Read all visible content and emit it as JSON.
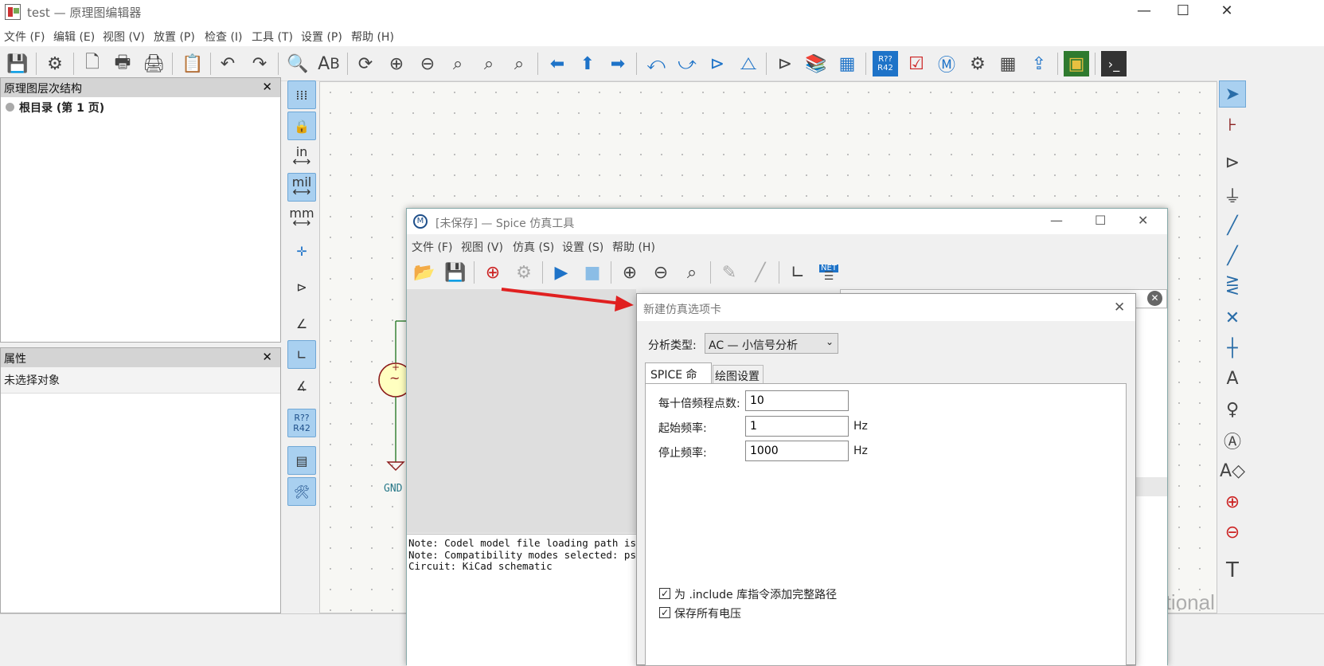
{
  "window": {
    "title": "test — 原理图编辑器",
    "minimize": "—",
    "maximize": "☐",
    "close": "✕"
  },
  "menu": [
    "文件 (F)",
    "编辑 (E)",
    "视图 (V)",
    "放置 (P)",
    "检查 (I)",
    "工具 (T)",
    "设置 (P)",
    "帮助 (H)"
  ],
  "toolbar": [
    "save-icon",
    "schematic-setup-icon",
    "page-settings-icon",
    "print-icon",
    "plot-icon",
    "paste-icon",
    "undo-icon",
    "redo-icon",
    "find-icon",
    "find-replace-icon",
    "refresh-icon",
    "zoom-in-icon",
    "zoom-out-icon",
    "zoom-fit-icon",
    "zoom-objects-icon",
    "zoom-selection-icon",
    "navigate-back-icon",
    "navigate-up-icon",
    "navigate-forward-icon",
    "rotate-ccw-icon",
    "rotate-cw-icon",
    "mirror-v-icon",
    "mirror-h-icon",
    "symbol-editor-icon",
    "symbol-browser-icon",
    "footprint-editor-icon",
    "annotate-icon",
    "erc-icon",
    "simulator-icon",
    "assign-footprints-icon",
    "bom-table-icon",
    "bom-export-icon",
    "pcb-editor-icon",
    "scripting-console-icon"
  ],
  "hierarchy": {
    "title": "原理图层次结构",
    "close": "✕",
    "root": "根目录 (第 1 页)"
  },
  "properties": {
    "title": "属性",
    "close": "✕",
    "empty": "未选择对象"
  },
  "left_toolbar": {
    "in": "in",
    "mil": "mil",
    "mm": "mm",
    "annotate_top": "R??",
    "annotate_bottom": "R42"
  },
  "canvas": {
    "gnd_label": "GND",
    "plus": "+",
    "source": "~"
  },
  "watermark": "CSDN @FakeOccupational",
  "spice": {
    "title": "[未保存] — Spice 仿真工具",
    "menu": [
      "文件 (F)",
      "视图 (V)",
      "仿真 (S)",
      "设置 (S)",
      "帮助 (H)"
    ],
    "log": [
      "Note: Codel model file loading path is",
      "Note: Compatibility modes selected: ps",
      "Circuit: KiCad schematic"
    ],
    "net_badge": "NET"
  },
  "dialog": {
    "title": "新建仿真选项卡",
    "analysis_label": "分析类型:",
    "analysis_value": "AC  —  小信号分析",
    "tabs": [
      "SPICE 命令",
      "绘图设置"
    ],
    "fields": [
      {
        "label": "每十倍频程点数:",
        "value": "10",
        "unit": ""
      },
      {
        "label": "起始频率:",
        "value": "1",
        "unit": "Hz"
      },
      {
        "label": "停止频率:",
        "value": "1000",
        "unit": "Hz"
      }
    ],
    "checkboxes": [
      {
        "label": "为 .include 库指令添加完整路径",
        "checked": true
      },
      {
        "label": "保存所有电压",
        "checked": true
      }
    ],
    "check_mark": "✓"
  }
}
